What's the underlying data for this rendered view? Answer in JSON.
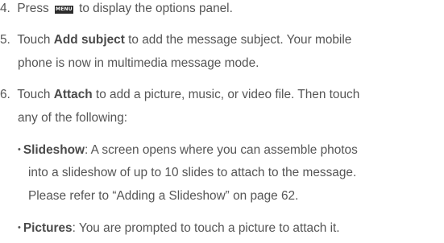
{
  "steps": [
    {
      "number": "4.",
      "text_before": "Press ",
      "key_label": "MENU",
      "text_after": " to display the options panel."
    },
    {
      "number": "5.",
      "text_before": "Touch ",
      "bold": "Add subject",
      "text_after": " to add the message subject. Your mobile",
      "line2": "phone is now in multimedia message mode."
    },
    {
      "number": "6.",
      "text_before": "Touch ",
      "bold": "Attach",
      "text_after": " to add a picture, music, or video file. Then touch",
      "line2": "any of the following:"
    }
  ],
  "options": [
    {
      "bullet": "•",
      "bold": "Slideshow",
      "text_after": ": A screen opens where you can assemble photos",
      "line2": "into a slideshow of up to 10 slides to attach to the message.",
      "line3": "Please refer to “Adding a Slideshow” on page 62."
    },
    {
      "bullet": "•",
      "bold": "Pictures",
      "text_after": ": You are prompted to touch a picture to attach it."
    }
  ]
}
